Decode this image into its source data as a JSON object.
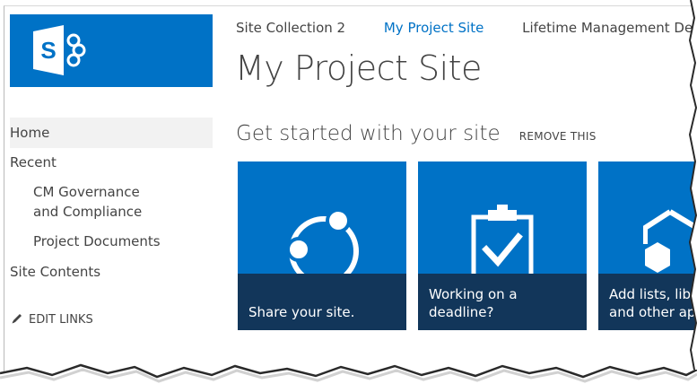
{
  "topnav": {
    "links": [
      "Site Collection 2",
      "My Project Site",
      "Lifetime Management Demo"
    ],
    "active": "My Project Site"
  },
  "site": {
    "title": "My Project Site"
  },
  "quicklaunch": {
    "items": [
      {
        "label": "Home"
      },
      {
        "label": "Recent"
      },
      {
        "label": "CM Governance and Compliance"
      },
      {
        "label": "Project Documents"
      },
      {
        "label": "Site Contents"
      }
    ],
    "edit_links": "EDIT LINKS"
  },
  "get_started": {
    "heading": "Get started with your site",
    "remove": "REMOVE THIS",
    "tiles": [
      {
        "caption": "Share your site.",
        "icon": "share-icon"
      },
      {
        "caption": "Working on a deadline?",
        "icon": "clipboard-check-icon"
      },
      {
        "caption": "Add lists, libraries, and other apps.",
        "icon": "hexagon-apps-icon"
      }
    ]
  },
  "colors": {
    "brand": "#0072c6",
    "tile_caption": "#12365a",
    "link_active": "#0072c6"
  }
}
